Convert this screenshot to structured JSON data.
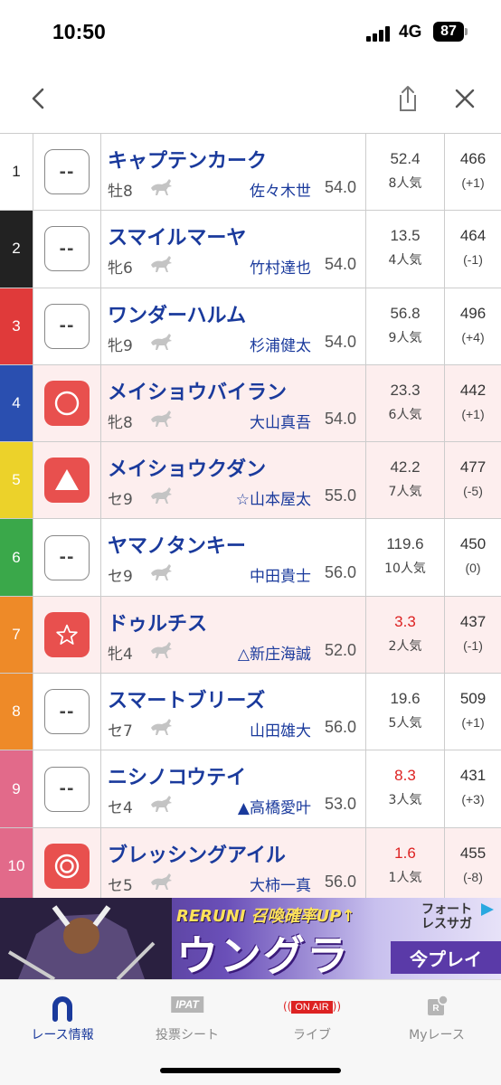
{
  "status": {
    "time": "10:50",
    "network": "4G",
    "battery": "87"
  },
  "nav": {
    "back_icon": "chevron-left-icon",
    "share_icon": "share-icon",
    "close_icon": "close-icon"
  },
  "colors": {
    "accent": "#1a3a9c",
    "mark_red": "#e8504e",
    "highlight_bg": "#fdeeee"
  },
  "runners": [
    {
      "num": "1",
      "num_bg": "#ffffff",
      "num_color": "#222222",
      "mark": "--",
      "mark_type": "empty",
      "highlight": false,
      "name": "キャプテンカーク",
      "sexage": "牡8",
      "jockey": "佐々木世",
      "kg": "54.0",
      "odds": "52.4",
      "odds_red": false,
      "pop": "8人気",
      "bw": "466",
      "bwd": "(+1)"
    },
    {
      "num": "2",
      "num_bg": "#222222",
      "num_color": "#ffffff",
      "mark": "--",
      "mark_type": "empty",
      "highlight": false,
      "name": "スマイルマーヤ",
      "sexage": "牝6",
      "jockey": "竹村達也",
      "kg": "54.0",
      "odds": "13.5",
      "odds_red": false,
      "pop": "4人気",
      "bw": "464",
      "bwd": "(-1)"
    },
    {
      "num": "3",
      "num_bg": "#e03a3a",
      "num_color": "#ffffff",
      "mark": "--",
      "mark_type": "empty",
      "highlight": false,
      "name": "ワンダーハルム",
      "sexage": "牝9",
      "jockey": "杉浦健太",
      "kg": "54.0",
      "odds": "56.8",
      "odds_red": false,
      "pop": "9人気",
      "bw": "496",
      "bwd": "(+4)"
    },
    {
      "num": "4",
      "num_bg": "#2a4fb0",
      "num_color": "#ffffff",
      "mark": "○",
      "mark_type": "circle",
      "highlight": true,
      "name": "メイショウバイラン",
      "sexage": "牝8",
      "jockey": "大山真吾",
      "kg": "54.0",
      "odds": "23.3",
      "odds_red": false,
      "pop": "6人気",
      "bw": "442",
      "bwd": "(+1)"
    },
    {
      "num": "5",
      "num_bg": "#ecd22a",
      "num_color": "#ffffff",
      "mark": "▲",
      "mark_type": "triangle",
      "highlight": true,
      "name": "メイショウクダン",
      "sexage": "セ9",
      "jockey": "☆山本屋太",
      "kg": "55.0",
      "odds": "42.2",
      "odds_red": false,
      "pop": "7人気",
      "bw": "477",
      "bwd": "(-5)"
    },
    {
      "num": "6",
      "num_bg": "#3aa84a",
      "num_color": "#ffffff",
      "mark": "--",
      "mark_type": "empty",
      "highlight": false,
      "name": "ヤマノタンキー",
      "sexage": "セ9",
      "jockey": "中田貴士",
      "kg": "56.0",
      "odds": "119.6",
      "odds_red": false,
      "pop": "10人気",
      "bw": "450",
      "bwd": "(0)"
    },
    {
      "num": "7",
      "num_bg": "#ee8a28",
      "num_color": "#ffffff",
      "mark": "☆",
      "mark_type": "star",
      "highlight": true,
      "name": "ドゥルチス",
      "sexage": "牝4",
      "jockey": "△新庄海誠",
      "kg": "52.0",
      "odds": "3.3",
      "odds_red": true,
      "pop": "2人気",
      "bw": "437",
      "bwd": "(-1)"
    },
    {
      "num": "8",
      "num_bg": "#ee8a28",
      "num_color": "#ffffff",
      "mark": "--",
      "mark_type": "empty",
      "highlight": false,
      "name": "スマートブリーズ",
      "sexage": "セ7",
      "jockey": "山田雄大",
      "kg": "56.0",
      "odds": "19.6",
      "odds_red": false,
      "pop": "5人気",
      "bw": "509",
      "bwd": "(+1)"
    },
    {
      "num": "9",
      "num_bg": "#e26a8a",
      "num_color": "#ffffff",
      "mark": "--",
      "mark_type": "empty",
      "highlight": false,
      "name": "ニシノコウテイ",
      "sexage": "セ4",
      "jockey": "▲高橋愛叶",
      "kg": "53.0",
      "odds": "8.3",
      "odds_red": true,
      "pop": "3人気",
      "bw": "431",
      "bwd": "(+3)"
    },
    {
      "num": "10",
      "num_bg": "#e26a8a",
      "num_color": "#ffffff",
      "mark": "◎",
      "mark_type": "double",
      "highlight": true,
      "name": "ブレッシングアイル",
      "sexage": "セ5",
      "jockey": "大柿一真",
      "kg": "56.0",
      "odds": "1.6",
      "odds_red": true,
      "pop": "1人気",
      "bw": "455",
      "bwd": "(-8)"
    }
  ],
  "ad": {
    "top": "RERUNI 召喚確率UP↑",
    "main": "ウングラ",
    "side": "フォートレスサガ",
    "play": "今プレイ"
  },
  "tabs": [
    {
      "label": "レース情報",
      "icon": "horseshoe-icon",
      "active": true
    },
    {
      "label": "投票シート",
      "icon": "ipat-icon",
      "badge": "IPAT",
      "active": false
    },
    {
      "label": "ライブ",
      "icon": "on-air-icon",
      "badge": "ON AIR",
      "active": false
    },
    {
      "label": "Myレース",
      "icon": "my-race-icon",
      "active": false
    }
  ]
}
